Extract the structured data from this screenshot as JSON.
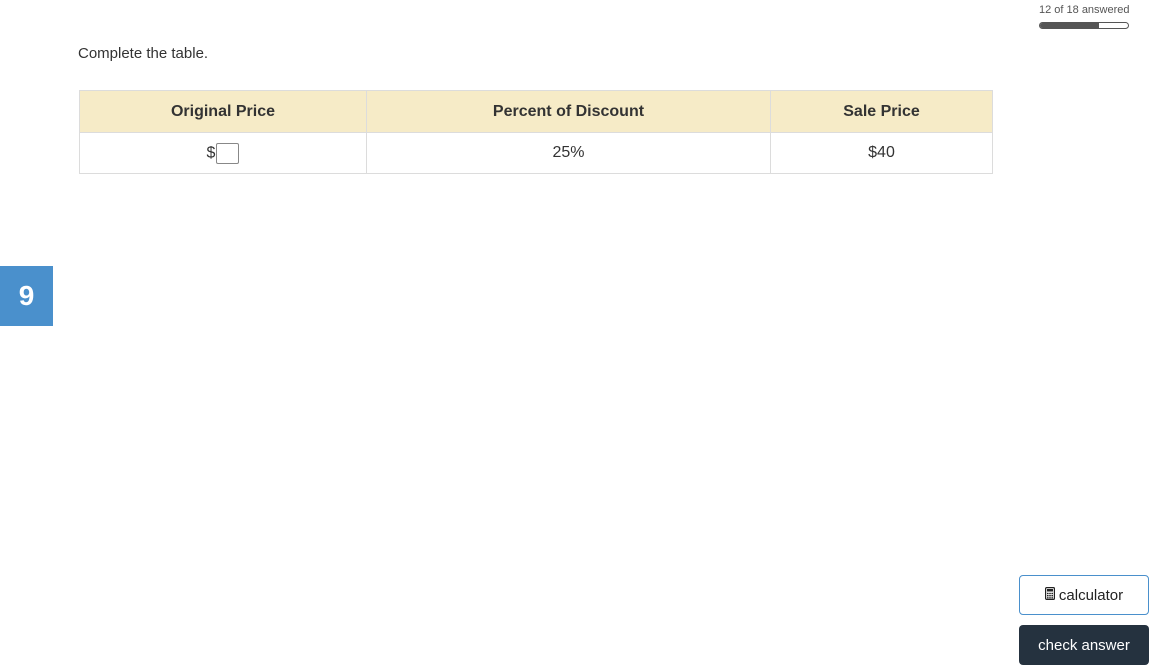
{
  "progress": {
    "label": "12 of 18 answered",
    "answered": 12,
    "total": 18
  },
  "question": {
    "number": "9",
    "prompt": "Complete the table."
  },
  "table": {
    "headers": [
      "Original Price",
      "Percent of Discount",
      "Sale Price"
    ],
    "row": {
      "currency_prefix": "$",
      "original_price_value": "",
      "percent_of_discount": "25%",
      "sale_price": "$40"
    }
  },
  "tools": {
    "calculator_label": "calculator",
    "calculator_icon": "calculator-icon",
    "check_answer_label": "check answer"
  },
  "colors": {
    "accent": "#4a90cc",
    "header_bg": "#f6ebc7",
    "check_button_bg": "#25323f"
  }
}
